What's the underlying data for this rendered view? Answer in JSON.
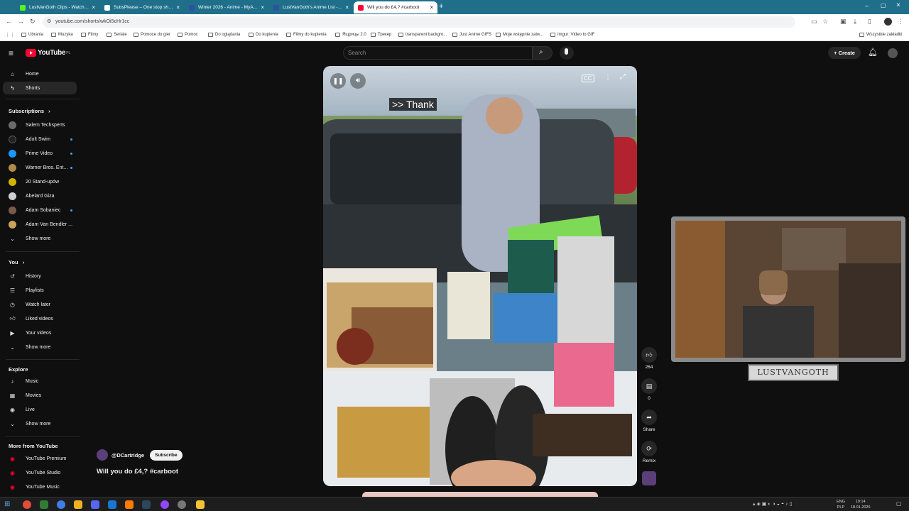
{
  "browser": {
    "tabs": [
      {
        "title": "LustVanGoth Clips - Watch Live",
        "fav": "#53fc18"
      },
      {
        "title": "SubsPlease – One stop shop fo",
        "fav": "#ffffff"
      },
      {
        "title": "Winter 2026 - Anime - MyAnim",
        "fav": "#2e51a2"
      },
      {
        "title": "LustVanGoth's Anime List - My",
        "fav": "#2e51a2"
      },
      {
        "title": "Will you do £4,? #carboot",
        "fav": "#ff0033"
      }
    ],
    "url": "youtube.com/shorts/wkOi5cHr1cc",
    "bookmarks": [
      "Ubrania",
      "Muzyka",
      "Filmy",
      "Seriale",
      "Pomoce do gier",
      "Pomoc",
      "Do oglądania",
      "Do kupienia",
      "Filmy do kupienia",
      "Ящрицы 2.0",
      "Трекер",
      "transparent backgro...",
      "Just Anime GIFS",
      "Moje wstępnie zatw...",
      "Imgur: Video to GIF",
      "Wszystkie zakładki"
    ]
  },
  "header": {
    "logo_text": "YouTube",
    "logo_country": "PL",
    "search_placeholder": "Search",
    "create_label": "Create"
  },
  "sidebar": {
    "main": [
      {
        "label": "Home",
        "icon": "home-icon"
      },
      {
        "label": "Shorts",
        "icon": "shorts-icon"
      }
    ],
    "subscriptions_heading": "Subscriptions",
    "subscriptions": [
      {
        "label": "Salem Techsperts",
        "color": "#6b6b6b",
        "dot": false
      },
      {
        "label": "Adult Swim",
        "color": "#222222",
        "dot": true
      },
      {
        "label": "Prime Video",
        "color": "#1a98ff",
        "dot": true
      },
      {
        "label": "Warner Bros. Ent...",
        "color": "#b08a4a",
        "dot": true
      },
      {
        "label": "20 Stand-upów",
        "color": "#d4b200",
        "dot": false
      },
      {
        "label": "Abelard Giza",
        "color": "#cfcfcf",
        "dot": false
      },
      {
        "label": "Adam Sobaniec",
        "color": "#7a5a48",
        "dot": true
      },
      {
        "label": "Adam Van Bendler ...",
        "color": "#caa25a",
        "dot": false
      }
    ],
    "show_more": "Show more",
    "you_heading": "You",
    "you": [
      {
        "label": "History",
        "icon": "history-icon"
      },
      {
        "label": "Playlists",
        "icon": "playlists-icon"
      },
      {
        "label": "Watch later",
        "icon": "watch-later-icon"
      },
      {
        "label": "Liked videos",
        "icon": "liked-videos-icon"
      },
      {
        "label": "Your videos",
        "icon": "your-videos-icon"
      }
    ],
    "explore_heading": "Explore",
    "explore": [
      {
        "label": "Music",
        "icon": "music-icon"
      },
      {
        "label": "Movies",
        "icon": "movies-icon"
      },
      {
        "label": "Live",
        "icon": "live-icon"
      }
    ],
    "more_heading": "More from YouTube",
    "more": [
      {
        "label": "YouTube Premium"
      },
      {
        "label": "YouTube Studio"
      },
      {
        "label": "YouTube Music"
      }
    ]
  },
  "video": {
    "caption": ">> Thank",
    "channel": "@DCartridge",
    "subscribe_label": "Subscribe",
    "title": "Will you do £4,? #carboot"
  },
  "actions": {
    "likes": "264",
    "comments": "0",
    "share": "Share",
    "remix": "Remix"
  },
  "overlay": {
    "streamer_name": "LUSTVANGOTH"
  },
  "taskbar": {
    "lang_top": "ENG",
    "lang_bottom": "PLP",
    "time": "19:14",
    "date": "18.01.2026"
  }
}
